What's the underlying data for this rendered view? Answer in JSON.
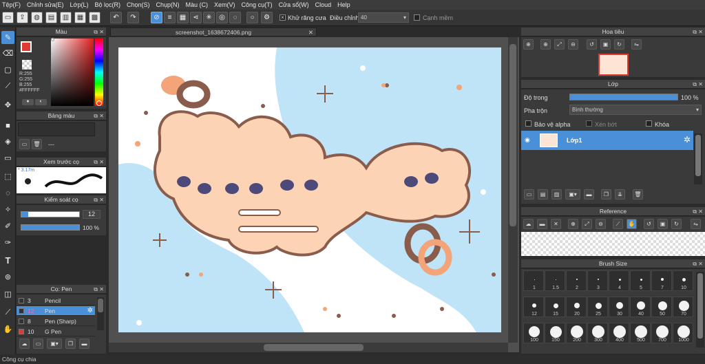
{
  "menu": [
    "Tệp(F)",
    "Chỉnh sửa(E)",
    "Lớp(L)",
    "Bộ lọc(R)",
    "Chọn(S)",
    "Chụp(N)",
    "Màu (C)",
    "Xem(V)",
    "Công cụ(T)",
    "Cửa sổ(W)",
    "Cloud",
    "Help"
  ],
  "toolbar": {
    "antialias_label": "Khử răng cưa",
    "antialias_checked": "×",
    "adjust_label": "Điều chỉnh",
    "adjust_value": "40",
    "smooth_label": "Cạnh mềm"
  },
  "color_panel": {
    "title": "Màu",
    "fg_color": "#E03B33",
    "bg_color": "#F5A274",
    "r": "R:255",
    "g": "G:255",
    "b": "B:255",
    "hex": "#FFFFFF"
  },
  "palette_panel": {
    "title": "Bảng màu",
    "value": "---"
  },
  "preview_panel": {
    "title": "Xem trước cọ",
    "size": "3.17m"
  },
  "brush_control": {
    "title": "Kiểm soát cọ",
    "size_value": "12",
    "opacity_value": "100 %",
    "size_fill": 0.12,
    "opacity_fill": 1.0
  },
  "brush_panel": {
    "title": "Cọ: Pen",
    "items": [
      {
        "num": "3",
        "name": "Pencil",
        "swatch": "#333333",
        "selected": false
      },
      {
        "num": "12",
        "name": "Pen",
        "swatch": "#333333",
        "selected": true
      },
      {
        "num": "8",
        "name": "Pen (Sharp)",
        "swatch": "#333333",
        "selected": false
      },
      {
        "num": "10",
        "name": "G Pen",
        "swatch": "#E03B33",
        "selected": false
      }
    ]
  },
  "document": {
    "tab_title": "screenshot_1638672406.png"
  },
  "navigator": {
    "title": "Hoa tiêu"
  },
  "layer_panel": {
    "title": "Lớp",
    "opacity_label": "Độ trong",
    "opacity_value": "100 %",
    "opacity_fill": 1.0,
    "blend_label": "Pha trộn",
    "blend_value": "Bình thường",
    "protect_alpha": "Bảo vệ alpha",
    "clipping": "Xén bớt",
    "lock": "Khóa",
    "layers": [
      {
        "name": "Lớp1"
      }
    ]
  },
  "reference_panel": {
    "title": "Reference"
  },
  "brush_size_panel": {
    "title": "Brush Size",
    "sizes": [
      "1",
      "1.5",
      "2",
      "3",
      "4",
      "5",
      "7",
      "10",
      "12",
      "15",
      "20",
      "25",
      "30",
      "40",
      "50",
      "70",
      "100",
      "150",
      "200",
      "300",
      "400",
      "500",
      "700",
      "1000"
    ]
  },
  "status": {
    "text": "Công cụ chia"
  },
  "icons": {
    "tool_active": "brush-icon"
  }
}
